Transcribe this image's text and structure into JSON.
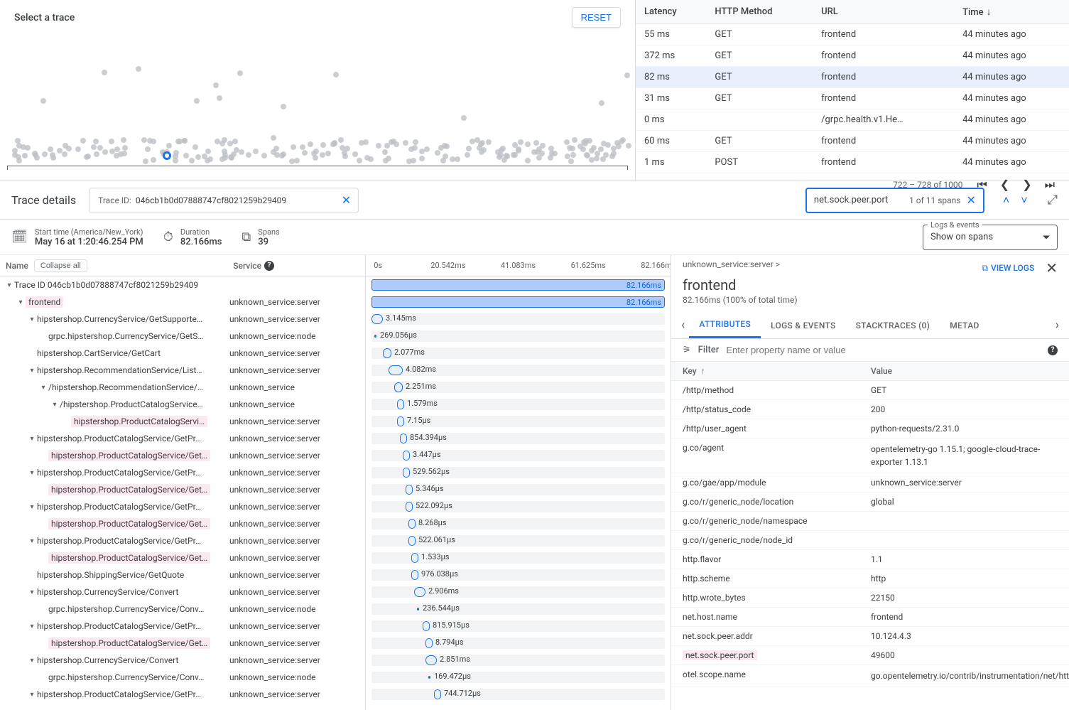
{
  "scatter": {
    "title": "Select a trace",
    "reset": "RESET"
  },
  "traceTable": {
    "headers": {
      "latency": "Latency",
      "method": "HTTP Method",
      "url": "URL",
      "time": "Time"
    },
    "rows": [
      {
        "latency": "55 ms",
        "method": "GET",
        "url": "frontend",
        "time": "44 minutes ago",
        "selected": false
      },
      {
        "latency": "372 ms",
        "method": "GET",
        "url": "frontend",
        "time": "44 minutes ago",
        "selected": false
      },
      {
        "latency": "82 ms",
        "method": "GET",
        "url": "frontend",
        "time": "44 minutes ago",
        "selected": true
      },
      {
        "latency": "31 ms",
        "method": "GET",
        "url": "frontend",
        "time": "44 minutes ago",
        "selected": false
      },
      {
        "latency": "0 ms",
        "method": "",
        "url": "/grpc.health.v1.He…",
        "time": "44 minutes ago",
        "selected": false
      },
      {
        "latency": "60 ms",
        "method": "GET",
        "url": "frontend",
        "time": "44 minutes ago",
        "selected": false
      },
      {
        "latency": "1 ms",
        "method": "POST",
        "url": "frontend",
        "time": "44 minutes ago",
        "selected": false
      }
    ],
    "pager": "722 – 728 of 1000"
  },
  "details": {
    "title": "Trace details",
    "traceIdLabel": "Trace ID:",
    "traceId": "046cb1b0d07888747cf8021259b29409",
    "searchValue": "net.sock.peer.port",
    "searchCount": "1 of 11 spans"
  },
  "meta": {
    "start": {
      "label": "Start time (America/New_York)",
      "value": "May 16 at 1:20:46.254 PM"
    },
    "duration": {
      "label": "Duration",
      "value": "82.166ms"
    },
    "spans": {
      "label": "Spans",
      "value": "39"
    },
    "logs": {
      "legend": "Logs & events",
      "value": "Show on spans"
    }
  },
  "treeHead": {
    "name": "Name",
    "collapse": "Collapse all",
    "service": "Service"
  },
  "wfTicks": [
    "0s",
    "20.542ms",
    "41.083ms",
    "61.625ms",
    "82.166ms"
  ],
  "spans": [
    {
      "depth": 0,
      "caret": "v",
      "name": "Trace ID 046cb1b0d07888747cf8021259b29409",
      "svc": "",
      "hl": false,
      "bar": {
        "type": "big",
        "l": 0,
        "w": 100,
        "label": "82.166ms"
      }
    },
    {
      "depth": 1,
      "caret": "v",
      "name": "frontend",
      "svc": "unknown_service:server",
      "hl": true,
      "bar": {
        "type": "big",
        "l": 0,
        "w": 100,
        "label": "82.166ms"
      }
    },
    {
      "depth": 2,
      "caret": "v",
      "name": "hipstershop.CurrencyService/GetSupporte…",
      "svc": "unknown_service:server",
      "hl": false,
      "bar": {
        "type": "pill",
        "l": 0,
        "w": 4,
        "label": "3.145ms"
      }
    },
    {
      "depth": 3,
      "caret": "",
      "name": "grpc.hipstershop.CurrencyService/GetS…",
      "svc": "unknown_service:node",
      "hl": false,
      "bar": {
        "type": "thin",
        "l": 1,
        "w": 1,
        "label": "269.056µs"
      }
    },
    {
      "depth": 2,
      "caret": "",
      "name": "hipstershop.CartService/GetCart",
      "svc": "unknown_service:server",
      "hl": false,
      "bar": {
        "type": "pill",
        "l": 4,
        "w": 3,
        "label": "2.077ms"
      }
    },
    {
      "depth": 2,
      "caret": "v",
      "name": "hipstershop.RecommendationService/List…",
      "svc": "unknown_service:server",
      "hl": false,
      "bar": {
        "type": "pill",
        "l": 6,
        "w": 5,
        "label": "4.082ms"
      }
    },
    {
      "depth": 3,
      "caret": "v",
      "name": "/hipstershop.RecommendationService/…",
      "svc": "unknown_service",
      "hl": false,
      "bar": {
        "type": "pill",
        "l": 8,
        "w": 3,
        "label": "2.251ms"
      }
    },
    {
      "depth": 4,
      "caret": "v",
      "name": "/hipstershop.ProductCatalogService…",
      "svc": "unknown_service",
      "hl": false,
      "bar": {
        "type": "pill",
        "l": 9,
        "w": 2,
        "label": "1.579ms"
      }
    },
    {
      "depth": 5,
      "caret": "",
      "name": "hipstershop.ProductCatalogServi…",
      "svc": "unknown_service:server",
      "hl": true,
      "bar": {
        "type": "pill",
        "l": 9,
        "w": 1,
        "label": "7.15µs"
      }
    },
    {
      "depth": 2,
      "caret": "v",
      "name": "hipstershop.ProductCatalogService/GetPr…",
      "svc": "unknown_service:server",
      "hl": false,
      "bar": {
        "type": "pill",
        "l": 10,
        "w": 1,
        "label": "854.394µs"
      }
    },
    {
      "depth": 3,
      "caret": "",
      "name": "hipstershop.ProductCatalogService/Get…",
      "svc": "unknown_service:server",
      "hl": true,
      "bar": {
        "type": "pill",
        "l": 11,
        "w": 1,
        "label": "3.447µs"
      }
    },
    {
      "depth": 2,
      "caret": "v",
      "name": "hipstershop.ProductCatalogService/GetPr…",
      "svc": "unknown_service:server",
      "hl": false,
      "bar": {
        "type": "pill",
        "l": 11,
        "w": 1,
        "label": "529.562µs"
      }
    },
    {
      "depth": 3,
      "caret": "",
      "name": "hipstershop.ProductCatalogService/Get…",
      "svc": "unknown_service:server",
      "hl": true,
      "bar": {
        "type": "pill",
        "l": 12,
        "w": 1,
        "label": "5.346µs"
      }
    },
    {
      "depth": 2,
      "caret": "v",
      "name": "hipstershop.ProductCatalogService/GetPr…",
      "svc": "unknown_service:server",
      "hl": false,
      "bar": {
        "type": "pill",
        "l": 12,
        "w": 1,
        "label": "522.092µs"
      }
    },
    {
      "depth": 3,
      "caret": "",
      "name": "hipstershop.ProductCatalogService/Get…",
      "svc": "unknown_service:server",
      "hl": true,
      "bar": {
        "type": "pill",
        "l": 13,
        "w": 1,
        "label": "8.268µs"
      }
    },
    {
      "depth": 2,
      "caret": "v",
      "name": "hipstershop.ProductCatalogService/GetPr…",
      "svc": "unknown_service:server",
      "hl": false,
      "bar": {
        "type": "pill",
        "l": 13,
        "w": 1,
        "label": "522.061µs"
      }
    },
    {
      "depth": 3,
      "caret": "",
      "name": "hipstershop.ProductCatalogService/Get…",
      "svc": "unknown_service:server",
      "hl": true,
      "bar": {
        "type": "pill",
        "l": 14,
        "w": 1,
        "label": "1.533µs"
      }
    },
    {
      "depth": 2,
      "caret": "",
      "name": "hipstershop.ShippingService/GetQuote",
      "svc": "unknown_service:server",
      "hl": false,
      "bar": {
        "type": "pill",
        "l": 14,
        "w": 1,
        "label": "976.038µs"
      }
    },
    {
      "depth": 2,
      "caret": "v",
      "name": "hipstershop.CurrencyService/Convert",
      "svc": "unknown_service:server",
      "hl": false,
      "bar": {
        "type": "pill",
        "l": 15,
        "w": 4,
        "label": "2.906ms"
      }
    },
    {
      "depth": 3,
      "caret": "",
      "name": "grpc.hipstershop.CurrencyService/Conv…",
      "svc": "unknown_service:node",
      "hl": false,
      "bar": {
        "type": "thin",
        "l": 16,
        "w": 1,
        "label": "236.544µs"
      }
    },
    {
      "depth": 2,
      "caret": "v",
      "name": "hipstershop.ProductCatalogService/GetPr…",
      "svc": "unknown_service:server",
      "hl": false,
      "bar": {
        "type": "pill",
        "l": 18,
        "w": 1,
        "label": "815.915µs"
      }
    },
    {
      "depth": 3,
      "caret": "",
      "name": "hipstershop.ProductCatalogService/Get…",
      "svc": "unknown_service:server",
      "hl": true,
      "bar": {
        "type": "pill",
        "l": 19,
        "w": 1,
        "label": "8.794µs"
      }
    },
    {
      "depth": 2,
      "caret": "v",
      "name": "hipstershop.CurrencyService/Convert",
      "svc": "unknown_service:server",
      "hl": false,
      "bar": {
        "type": "pill",
        "l": 19,
        "w": 4,
        "label": "2.851ms"
      }
    },
    {
      "depth": 3,
      "caret": "",
      "name": "grpc.hipstershop.CurrencyService/Conv…",
      "svc": "unknown_service:node",
      "hl": false,
      "bar": {
        "type": "thin",
        "l": 20,
        "w": 1,
        "label": "169.472µs"
      }
    },
    {
      "depth": 2,
      "caret": "v",
      "name": "hipstershop.ProductCatalogService/GetPr…",
      "svc": "unknown_service:server",
      "hl": false,
      "bar": {
        "type": "pill",
        "l": 22,
        "w": 1,
        "label": "744.712µs"
      }
    }
  ],
  "attr": {
    "breadcrumb": "unknown_service:server >",
    "viewLogs": "VIEW LOGS",
    "title": "frontend",
    "subtitle": "82.166ms  (100% of total time)",
    "tabs": {
      "attributes": "ATTRIBUTES",
      "logs": "LOGS & EVENTS",
      "stack": "STACKTRACES (0)",
      "meta": "METAD"
    },
    "filter": {
      "label": "Filter",
      "placeholder": "Enter property name or value"
    },
    "kvHead": {
      "key": "Key",
      "value": "Value"
    },
    "kv": [
      {
        "k": "/http/method",
        "v": "GET"
      },
      {
        "k": "/http/status_code",
        "v": "200"
      },
      {
        "k": "/http/user_agent",
        "v": "python-requests/2.31.0"
      },
      {
        "k": "g.co/agent",
        "v": "opentelemetry-go 1.15.1; google-cloud-trace-exporter 1.13.1",
        "twoline": true
      },
      {
        "k": "g.co/gae/app/module",
        "v": "unknown_service:server"
      },
      {
        "k": "g.co/r/generic_node/location",
        "v": "global"
      },
      {
        "k": "g.co/r/generic_node/namespace",
        "v": ""
      },
      {
        "k": "g.co/r/generic_node/node_id",
        "v": ""
      },
      {
        "k": "http.flavor",
        "v": "1.1"
      },
      {
        "k": "http.scheme",
        "v": "http"
      },
      {
        "k": "http.wrote_bytes",
        "v": "22150"
      },
      {
        "k": "net.host.name",
        "v": "frontend"
      },
      {
        "k": "net.sock.peer.addr",
        "v": "10.124.4.3"
      },
      {
        "k": "net.sock.peer.port",
        "v": "49600",
        "hl": true
      },
      {
        "k": "otel.scope.name",
        "v": "go.opentelemetry.io/contrib/instrumentation/net/http/otelhttp",
        "twoline": true
      }
    ]
  }
}
